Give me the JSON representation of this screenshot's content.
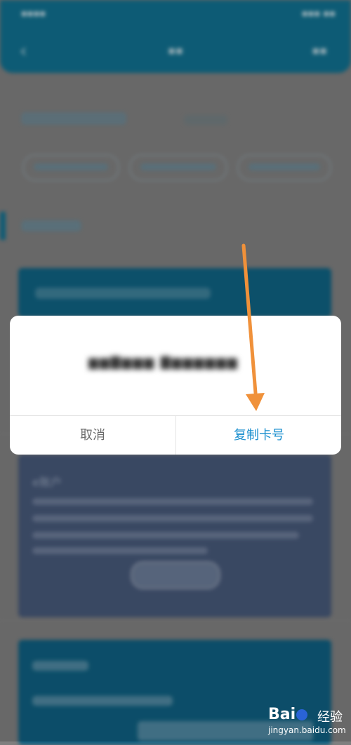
{
  "dialog": {
    "cancel_label": "取消",
    "copy_label": "复制卡号",
    "accent_color": "#1a8fcf"
  },
  "background": {
    "e_account_title": "e账户"
  },
  "annotation": {
    "arrow_color": "#f0913a"
  },
  "watermark": {
    "logo_text_left": "Bai",
    "logo_text_right": "经验",
    "url": "jingyan.baidu.com"
  }
}
